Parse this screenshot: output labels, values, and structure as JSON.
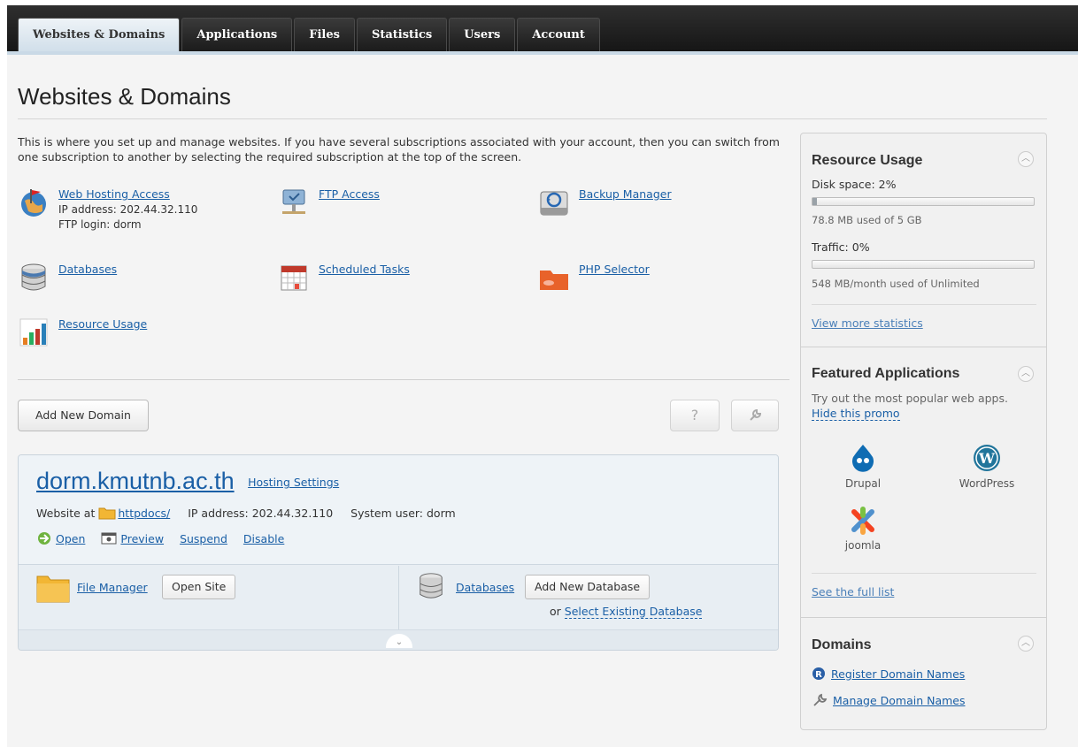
{
  "nav": {
    "tabs": [
      "Websites & Domains",
      "Applications",
      "Files",
      "Statistics",
      "Users",
      "Account"
    ],
    "active": "Websites & Domains"
  },
  "page": {
    "title": "Websites & Domains",
    "intro": "This is where you set up and manage websites. If you have several subscriptions associated with your account, then you can switch from one subscription to another by selecting the required subscription at the top of the screen."
  },
  "tools": {
    "web_hosting_access": "Web Hosting Access",
    "ip_line": "IP address: 202.44.32.110",
    "ftp_line": "FTP login: dorm",
    "ftp_access": "FTP Access",
    "backup_manager": "Backup Manager",
    "databases": "Databases",
    "scheduled_tasks": "Scheduled Tasks",
    "php_selector": "PHP Selector",
    "resource_usage": "Resource Usage"
  },
  "actions": {
    "add_domain": "Add New Domain",
    "help": "?"
  },
  "domain": {
    "name": "dorm.kmutnb.ac.th",
    "hosting_settings": "Hosting Settings",
    "website_at": "Website at",
    "docroot": "httpdocs/",
    "ip": "IP address: 202.44.32.110",
    "system_user": "System user: dorm",
    "open": "Open",
    "preview": "Preview",
    "suspend": "Suspend",
    "disable": "Disable",
    "file_manager": "File Manager",
    "open_site": "Open Site",
    "databases": "Databases",
    "add_db": "Add New Database",
    "or": "or",
    "select_db": "Select Existing Database"
  },
  "sidebar": {
    "resource": {
      "title": "Resource Usage",
      "disk_label": "Disk space: 2%",
      "disk_fraction": 0.02,
      "disk_detail": "78.8 MB used of 5 GB",
      "traffic_label": "Traffic: 0%",
      "traffic_fraction": 0.0,
      "traffic_detail": "548 MB/month used of Unlimited",
      "more": "View more statistics"
    },
    "featured": {
      "title": "Featured Applications",
      "desc": "Try out the most popular web apps.",
      "hide": "Hide this promo",
      "apps": [
        "Drupal",
        "WordPress",
        "joomla"
      ],
      "full_list": "See the full list"
    },
    "domains": {
      "title": "Domains",
      "register": "Register Domain Names",
      "manage": "Manage Domain Names"
    }
  },
  "colors": {
    "link": "#1a5fa6",
    "nav_bg": "#1e1e1e",
    "card_bg": "#eef3f7"
  }
}
